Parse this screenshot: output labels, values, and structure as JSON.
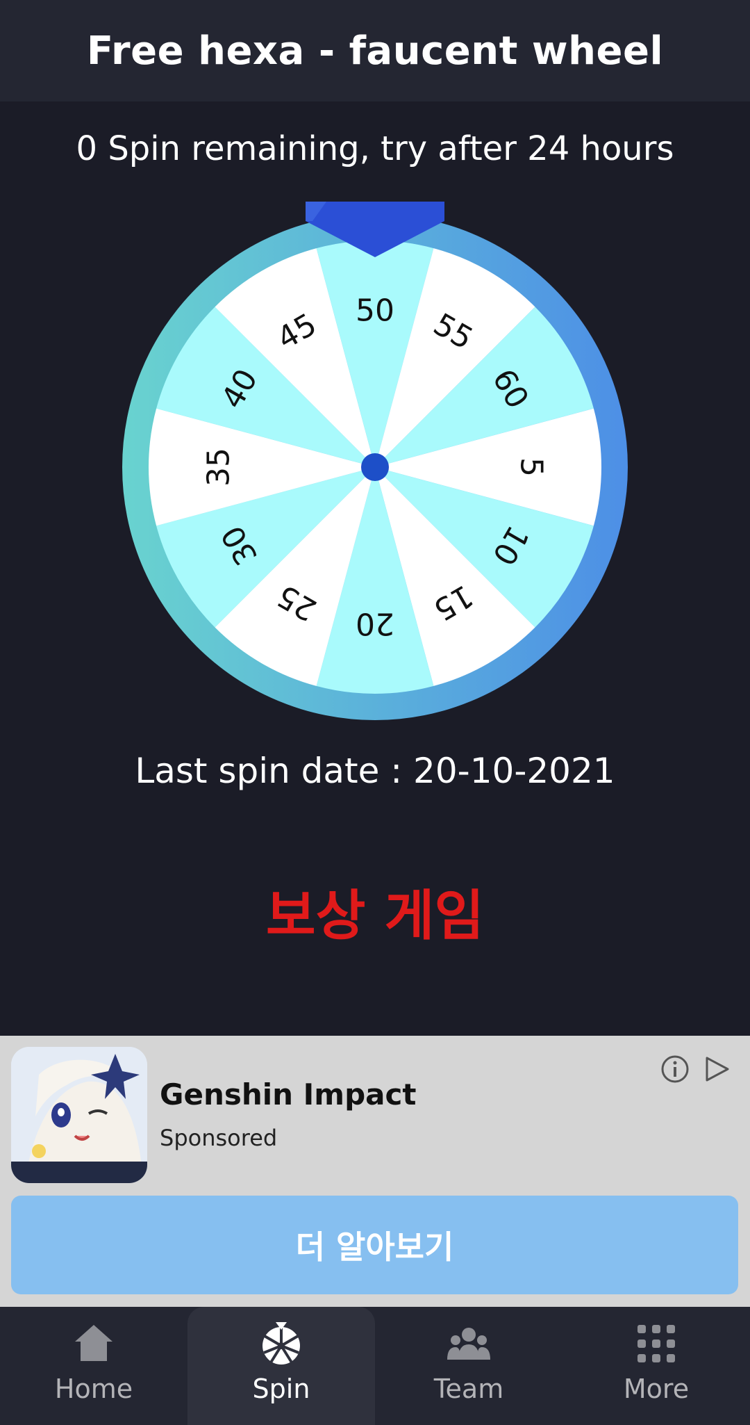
{
  "header": {
    "title": "Free hexa - faucent wheel"
  },
  "spin_status": "0 Spin remaining, try after 24 hours",
  "wheel": {
    "segments": [
      "5",
      "10",
      "15",
      "20",
      "25",
      "30",
      "35",
      "40",
      "45",
      "50",
      "55",
      "60"
    ],
    "colors": {
      "light": "#a9fafc",
      "white": "#ffffff",
      "pointer": "#2b4fd6",
      "hub": "#1d4fc8"
    }
  },
  "last_spin": "Last spin date : 20-10-2021",
  "reward_title": "보상 게임",
  "ad": {
    "icon_brand": "miHoYo",
    "title": "Genshin Impact",
    "sponsored": "Sponsored",
    "cta": "더 알아보기",
    "info_icon": "info-icon",
    "adchoices_icon": "adchoices-icon"
  },
  "nav": {
    "home": "Home",
    "spin": "Spin",
    "team": "Team",
    "more": "More"
  }
}
